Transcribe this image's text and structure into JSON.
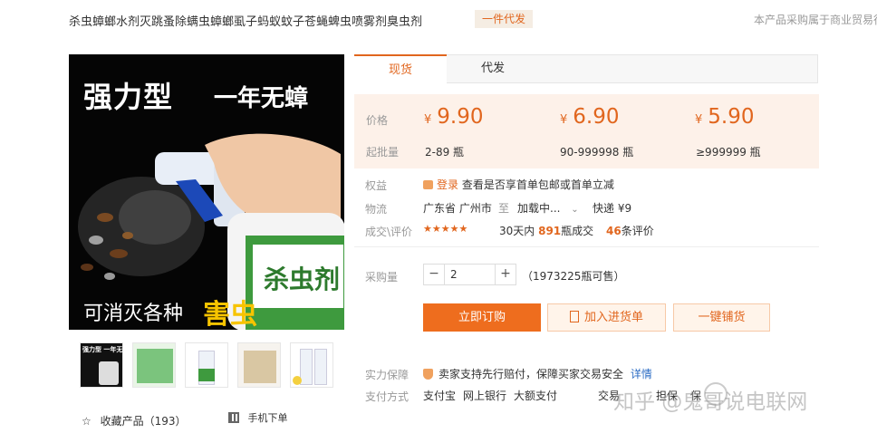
{
  "header": {
    "title": "杀虫蟑螂水剂灭跳蚤除螨虫蟑螂虱子蚂蚁蚊子苍蝇蜱虫喷雾剂臭虫剂",
    "badge": "一件代发",
    "notice": "本产品采购属于商业贸易行"
  },
  "product_image": {
    "headline_left": "强力型",
    "headline_right": "一年无蟑",
    "bottle_label": "杀虫剂",
    "bottom_text": "可消灭各种",
    "bottom_emphasis": "害虫"
  },
  "thumbnails": [
    {
      "label": "强力型 一年无蟑"
    },
    {
      "label": ""
    },
    {
      "label": ""
    },
    {
      "label": ""
    },
    {
      "label": ""
    }
  ],
  "favorite": {
    "star": "☆",
    "label": "收藏产品（193）"
  },
  "mobile_order": {
    "label": "手机下单"
  },
  "tabs": [
    {
      "label": "现货",
      "active": true
    },
    {
      "label": "代发",
      "active": false
    }
  ],
  "pricing": {
    "price_label": "价格",
    "moq_label": "起批量",
    "currency": "¥",
    "tiers": [
      {
        "price": "9.90",
        "range": "2-89 瓶"
      },
      {
        "price": "6.90",
        "range": "90-999998 瓶"
      },
      {
        "price": "5.90",
        "range": "≥999999 瓶"
      }
    ]
  },
  "benefits": {
    "label": "权益",
    "login": "登录",
    "text": "查看是否享首单包邮或首单立减"
  },
  "logistics": {
    "label": "物流",
    "origin": "广东省 广州市",
    "to": "至",
    "destination": "加载中...",
    "express": "快递 ¥9"
  },
  "reviews": {
    "label": "成交\\评价",
    "stars": "★★★★★",
    "sales_prefix": "30天内",
    "sales_count": "891",
    "sales_suffix": "瓶成交",
    "review_count": "46",
    "review_suffix": "条评价"
  },
  "purchase": {
    "label": "采购量",
    "minus": "−",
    "quantity": "2",
    "plus": "+",
    "stock": "（1973225瓶可售）"
  },
  "actions": {
    "order": "立即订购",
    "add": "加入进货单",
    "distribute": "一键铺货"
  },
  "guarantee": {
    "label": "实力保障",
    "text": "卖家支持先行赔付，保障买家交易安全",
    "detail": "详情"
  },
  "payment": {
    "label": "支付方式",
    "methods": [
      "支付宝",
      "网上银行",
      "大额支付"
    ],
    "extra": "交易",
    "extra2": "担保",
    "extra3": "保"
  },
  "watermark": {
    "text": "知乎 @鬼哥说电联网"
  },
  "colors": {
    "accent": "#e1661e",
    "price_bg": "#fdf1e9",
    "order_button": "#ee6d1e"
  }
}
